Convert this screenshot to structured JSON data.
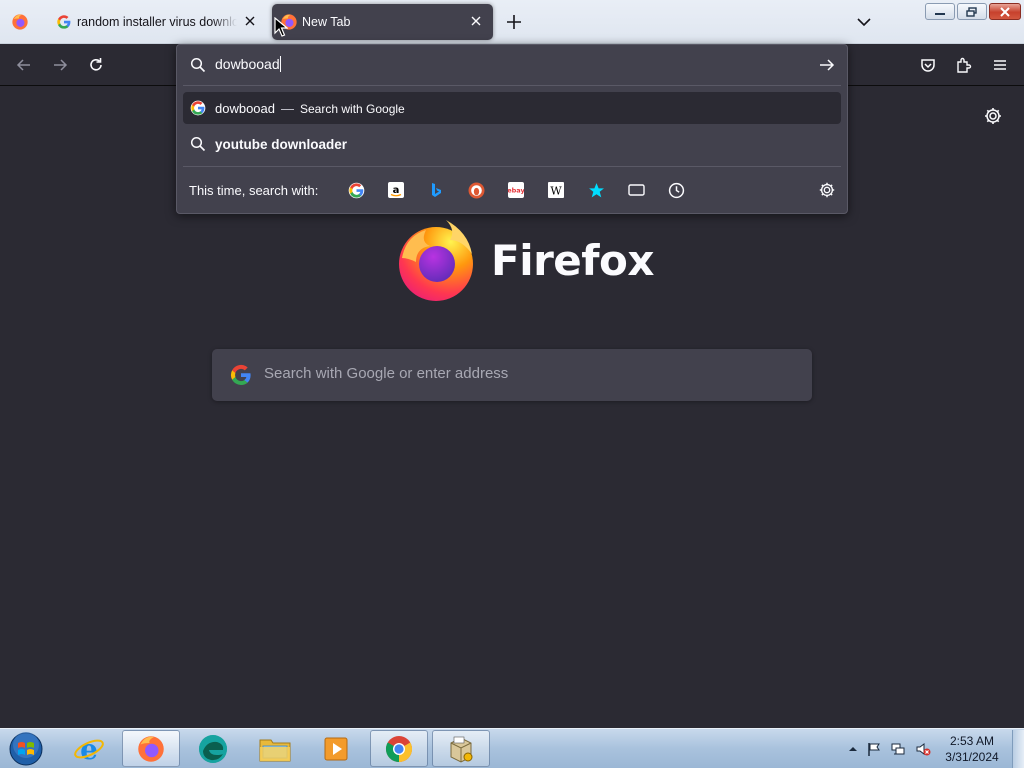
{
  "tabs": [
    {
      "title": "random installer virus download",
      "favicon": "google-g-icon",
      "active": false
    },
    {
      "title": "New Tab",
      "favicon": "firefox-icon",
      "active": true
    }
  ],
  "urlbar": {
    "value": "dowbooad",
    "results": [
      {
        "text": "dowbooad",
        "separator": "—",
        "action": "Search with Google",
        "icon": "google-g-icon"
      },
      {
        "text": "youtube downloader",
        "icon": "search-icon"
      }
    ],
    "oneoff_label": "This time, search with:",
    "oneoff_engines": [
      "google-icon",
      "amazon-icon",
      "bing-icon",
      "duckduckgo-icon",
      "ebay-icon",
      "wikipedia-icon",
      "bookmarks-icon",
      "tabs-icon",
      "history-icon"
    ]
  },
  "newtab": {
    "brand": "Firefox",
    "search_placeholder": "Search with Google or enter address"
  },
  "taskbar": {
    "items": [
      "start",
      "internet-explorer",
      "firefox",
      "edge",
      "file-explorer",
      "media-player",
      "chrome",
      "installer"
    ],
    "time": "2:53 AM",
    "date": "3/31/2024"
  },
  "colors": {
    "page_bg": "#2b2a33",
    "panel_bg": "#42414d",
    "text": "#fbfbfe"
  }
}
